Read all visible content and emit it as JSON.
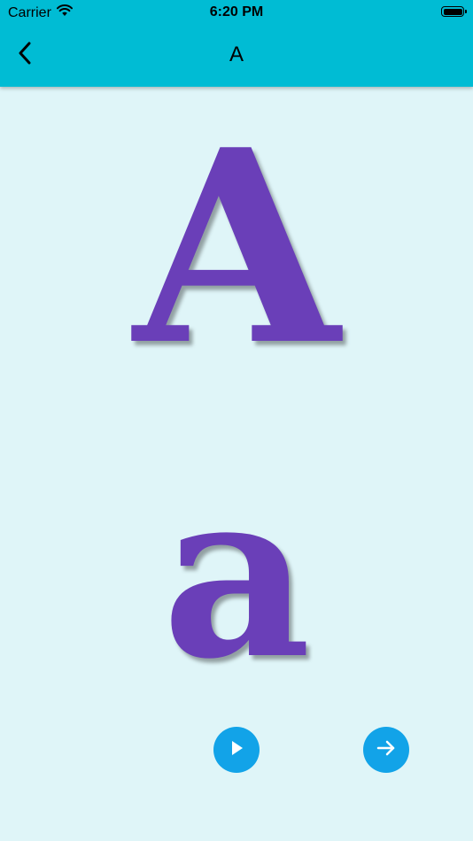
{
  "status_bar": {
    "carrier": "Carrier",
    "time": "6:20 PM",
    "wifi_icon": "wifi-icon",
    "battery_icon": "battery-icon"
  },
  "nav": {
    "title": "A",
    "back_icon": "chevron-left-icon"
  },
  "letters": {
    "uppercase": "A",
    "lowercase": "a"
  },
  "controls": {
    "play_icon": "play-icon",
    "next_icon": "arrow-right-icon"
  },
  "colors": {
    "header": "#00bcd4",
    "background": "#dff5f8",
    "letter": "#6a3fb8",
    "button": "#12a3e8"
  }
}
